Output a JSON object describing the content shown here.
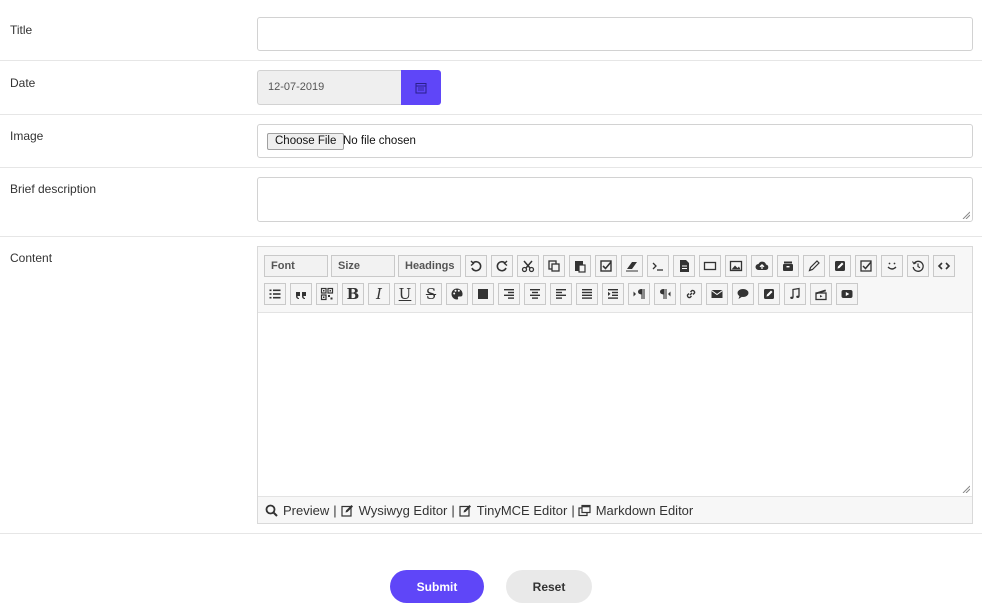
{
  "form": {
    "title_label": "Title",
    "title_value": "",
    "date_label": "Date",
    "date_value": "12-07-2019",
    "image_label": "Image",
    "file_button": "Choose File",
    "file_status": "No file chosen",
    "brief_label": "Brief description",
    "brief_value": "",
    "content_label": "Content"
  },
  "editor": {
    "font_label": "Font",
    "size_label": "Size",
    "headings_label": "Headings",
    "toolbar_row1_icons": [
      "undo-icon",
      "redo-icon",
      "cut-icon",
      "copy-icon",
      "paste-icon",
      "select-all-icon",
      "eraser-icon",
      "code-terminal-icon",
      "document-icon",
      "box-icon",
      "image-icon",
      "upload-icon",
      "archive-icon",
      "pen-icon",
      "edit-box-icon",
      "checkbox-edit-icon",
      "smiley-icon",
      "history-icon",
      "source-code-icon"
    ],
    "toolbar_row2_icons": [
      "list-icon",
      "quote-icon",
      "qr-icon",
      "bold-icon",
      "italic-icon",
      "underline-icon",
      "strikethrough-icon",
      "palette-icon",
      "fill-icon",
      "align-right-icon",
      "align-center-icon",
      "align-left-icon",
      "align-justify-icon",
      "indent-icon",
      "ltr-icon",
      "rtl-icon",
      "link-icon",
      "email-icon",
      "comment-icon",
      "embed-icon",
      "music-icon",
      "video-clip-icon",
      "youtube-icon"
    ],
    "bold_glyph": "B",
    "italic_glyph": "I",
    "underline_glyph": "U",
    "strike_glyph": "S",
    "footer": {
      "preview": "Preview",
      "wysiwyg": "Wysiwyg Editor",
      "tinymce": "TinyMCE Editor",
      "markdown": "Markdown Editor",
      "separator": "|"
    }
  },
  "actions": {
    "submit": "Submit",
    "reset": "Reset"
  },
  "colors": {
    "accent": "#5f46f8",
    "reset_bg": "#e9e9e9"
  }
}
